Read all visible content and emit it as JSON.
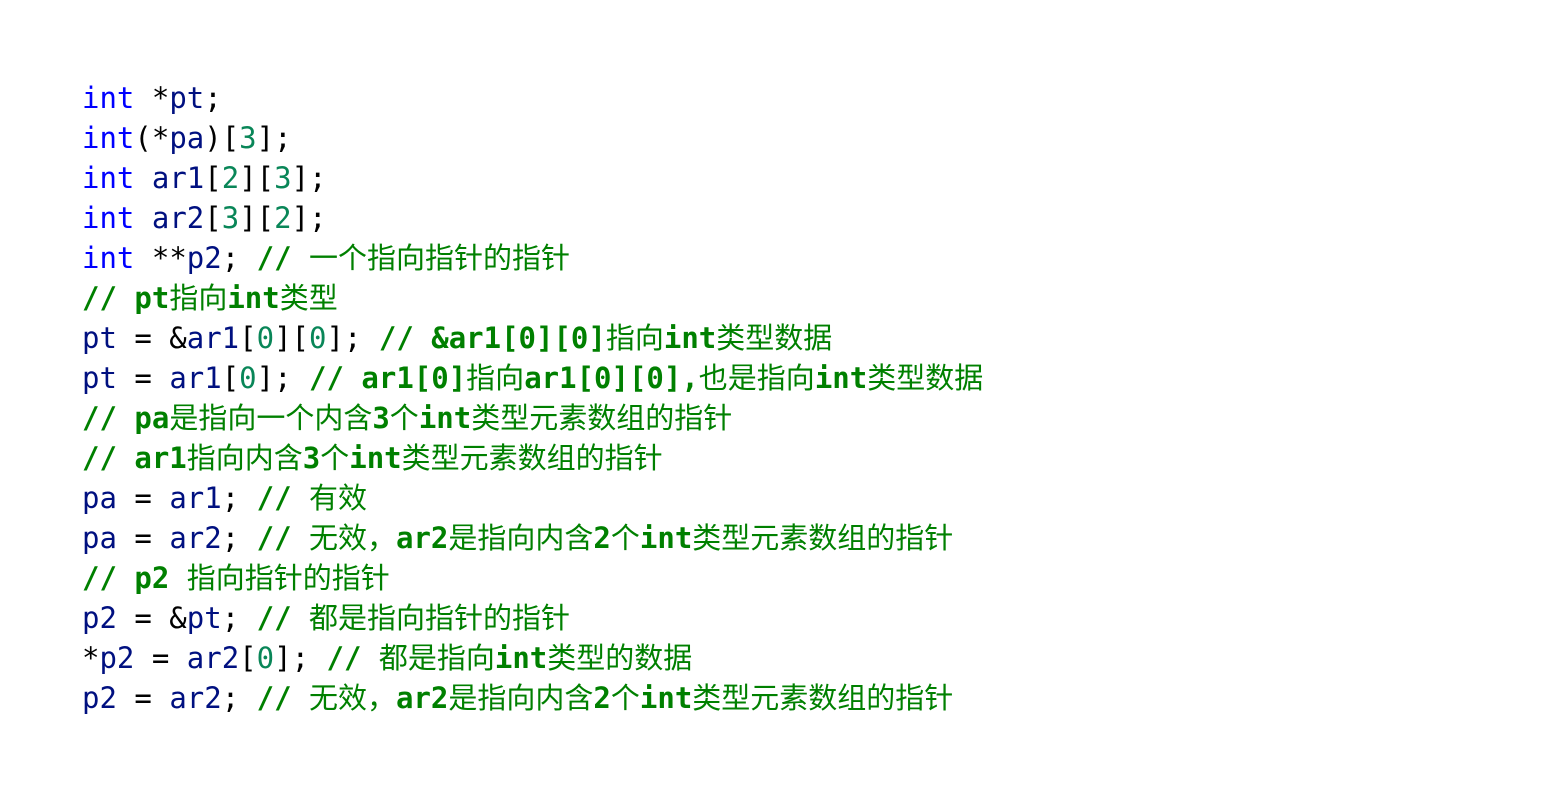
{
  "colors": {
    "keyword": "#0000ff",
    "identifier": "#001080",
    "number": "#098658",
    "comment": "#008000",
    "punctuation": "#000000",
    "background": "#ffffff"
  },
  "code_lines": [
    [
      {
        "t": "int",
        "k": "kw"
      },
      {
        "t": " ",
        "k": "punc"
      },
      {
        "t": "*",
        "k": "op"
      },
      {
        "t": "pt",
        "k": "id"
      },
      {
        "t": ";",
        "k": "punc"
      }
    ],
    [
      {
        "t": "int",
        "k": "kw"
      },
      {
        "t": "(*",
        "k": "punc"
      },
      {
        "t": "pa",
        "k": "id"
      },
      {
        "t": ")[",
        "k": "punc"
      },
      {
        "t": "3",
        "k": "num"
      },
      {
        "t": "];",
        "k": "punc"
      }
    ],
    [
      {
        "t": "int",
        "k": "kw"
      },
      {
        "t": " ",
        "k": "punc"
      },
      {
        "t": "ar1",
        "k": "id"
      },
      {
        "t": "[",
        "k": "punc"
      },
      {
        "t": "2",
        "k": "num"
      },
      {
        "t": "][",
        "k": "punc"
      },
      {
        "t": "3",
        "k": "num"
      },
      {
        "t": "];",
        "k": "punc"
      }
    ],
    [
      {
        "t": "int",
        "k": "kw"
      },
      {
        "t": " ",
        "k": "punc"
      },
      {
        "t": "ar2",
        "k": "id"
      },
      {
        "t": "[",
        "k": "punc"
      },
      {
        "t": "3",
        "k": "num"
      },
      {
        "t": "][",
        "k": "punc"
      },
      {
        "t": "2",
        "k": "num"
      },
      {
        "t": "];",
        "k": "punc"
      }
    ],
    [
      {
        "t": "int",
        "k": "kw"
      },
      {
        "t": " ",
        "k": "punc"
      },
      {
        "t": "**",
        "k": "op"
      },
      {
        "t": "p2",
        "k": "id"
      },
      {
        "t": "; ",
        "k": "punc"
      },
      {
        "t": "//",
        "k": "cm-b"
      },
      {
        "t": " 一个指向指针的指针",
        "k": "cm"
      }
    ],
    [
      {
        "t": "// pt",
        "k": "cm-b"
      },
      {
        "t": "指向",
        "k": "cm"
      },
      {
        "t": "int",
        "k": "cm-b"
      },
      {
        "t": "类型",
        "k": "cm"
      }
    ],
    [
      {
        "t": "pt",
        "k": "id"
      },
      {
        "t": " = &",
        "k": "op"
      },
      {
        "t": "ar1",
        "k": "id"
      },
      {
        "t": "[",
        "k": "punc"
      },
      {
        "t": "0",
        "k": "num"
      },
      {
        "t": "][",
        "k": "punc"
      },
      {
        "t": "0",
        "k": "num"
      },
      {
        "t": "]; ",
        "k": "punc"
      },
      {
        "t": "// &ar1[0][0]",
        "k": "cm-b"
      },
      {
        "t": "指向",
        "k": "cm"
      },
      {
        "t": "int",
        "k": "cm-b"
      },
      {
        "t": "类型数据",
        "k": "cm"
      }
    ],
    [
      {
        "t": "pt",
        "k": "id"
      },
      {
        "t": " = ",
        "k": "op"
      },
      {
        "t": "ar1",
        "k": "id"
      },
      {
        "t": "[",
        "k": "punc"
      },
      {
        "t": "0",
        "k": "num"
      },
      {
        "t": "]; ",
        "k": "punc"
      },
      {
        "t": "// ar1[0]",
        "k": "cm-b"
      },
      {
        "t": "指向",
        "k": "cm"
      },
      {
        "t": "ar1[0][0],",
        "k": "cm-b"
      },
      {
        "t": "也是指向",
        "k": "cm"
      },
      {
        "t": "int",
        "k": "cm-b"
      },
      {
        "t": "类型数据",
        "k": "cm"
      }
    ],
    [
      {
        "t": "// pa",
        "k": "cm-b"
      },
      {
        "t": "是指向一个内含",
        "k": "cm"
      },
      {
        "t": "3",
        "k": "cm-b"
      },
      {
        "t": "个",
        "k": "cm"
      },
      {
        "t": "int",
        "k": "cm-b"
      },
      {
        "t": "类型元素数组的指针",
        "k": "cm"
      }
    ],
    [
      {
        "t": "// ar1",
        "k": "cm-b"
      },
      {
        "t": "指向内含",
        "k": "cm"
      },
      {
        "t": "3",
        "k": "cm-b"
      },
      {
        "t": "个",
        "k": "cm"
      },
      {
        "t": "int",
        "k": "cm-b"
      },
      {
        "t": "类型元素数组的指针",
        "k": "cm"
      }
    ],
    [
      {
        "t": "pa",
        "k": "id"
      },
      {
        "t": " = ",
        "k": "op"
      },
      {
        "t": "ar1",
        "k": "id"
      },
      {
        "t": "; ",
        "k": "punc"
      },
      {
        "t": "//",
        "k": "cm-b"
      },
      {
        "t": " 有效",
        "k": "cm"
      }
    ],
    [
      {
        "t": "pa",
        "k": "id"
      },
      {
        "t": " = ",
        "k": "op"
      },
      {
        "t": "ar2",
        "k": "id"
      },
      {
        "t": "; ",
        "k": "punc"
      },
      {
        "t": "//",
        "k": "cm-b"
      },
      {
        "t": " 无效，",
        "k": "cm"
      },
      {
        "t": "ar2",
        "k": "cm-b"
      },
      {
        "t": "是指向内含",
        "k": "cm"
      },
      {
        "t": "2",
        "k": "cm-b"
      },
      {
        "t": "个",
        "k": "cm"
      },
      {
        "t": "int",
        "k": "cm-b"
      },
      {
        "t": "类型元素数组的指针",
        "k": "cm"
      }
    ],
    [
      {
        "t": "// p2",
        "k": "cm-b"
      },
      {
        "t": " 指向指针的指针",
        "k": "cm"
      }
    ],
    [
      {
        "t": "p2",
        "k": "id"
      },
      {
        "t": " = &",
        "k": "op"
      },
      {
        "t": "pt",
        "k": "id"
      },
      {
        "t": "; ",
        "k": "punc"
      },
      {
        "t": "//",
        "k": "cm-b"
      },
      {
        "t": " 都是指向指针的指针",
        "k": "cm"
      }
    ],
    [
      {
        "t": "*",
        "k": "op"
      },
      {
        "t": "p2",
        "k": "id"
      },
      {
        "t": " = ",
        "k": "op"
      },
      {
        "t": "ar2",
        "k": "id"
      },
      {
        "t": "[",
        "k": "punc"
      },
      {
        "t": "0",
        "k": "num"
      },
      {
        "t": "]; ",
        "k": "punc"
      },
      {
        "t": "//",
        "k": "cm-b"
      },
      {
        "t": " 都是指向",
        "k": "cm"
      },
      {
        "t": "int",
        "k": "cm-b"
      },
      {
        "t": "类型的数据",
        "k": "cm"
      }
    ],
    [
      {
        "t": "p2",
        "k": "id"
      },
      {
        "t": " = ",
        "k": "op"
      },
      {
        "t": "ar2",
        "k": "id"
      },
      {
        "t": "; ",
        "k": "punc"
      },
      {
        "t": "//",
        "k": "cm-b"
      },
      {
        "t": " 无效，",
        "k": "cm"
      },
      {
        "t": "ar2",
        "k": "cm-b"
      },
      {
        "t": "是指向内含",
        "k": "cm"
      },
      {
        "t": "2",
        "k": "cm-b"
      },
      {
        "t": "个",
        "k": "cm"
      },
      {
        "t": "int",
        "k": "cm-b"
      },
      {
        "t": "类型元素数组的指针",
        "k": "cm"
      }
    ]
  ]
}
